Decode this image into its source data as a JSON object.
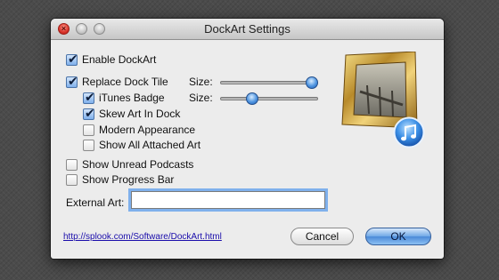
{
  "window": {
    "title": "DockArt Settings"
  },
  "options": {
    "enable_dockart": {
      "label": "Enable DockArt",
      "checked": true
    },
    "replace_dock_tile": {
      "label": "Replace Dock Tile",
      "checked": true
    },
    "itunes_badge": {
      "label": "iTunes Badge",
      "checked": true
    },
    "skew_art": {
      "label": "Skew Art In Dock",
      "checked": true
    },
    "modern_appearance": {
      "label": "Modern Appearance",
      "checked": false
    },
    "show_all_art": {
      "label": "Show All Attached Art",
      "checked": false
    },
    "show_unread_podcasts": {
      "label": "Show Unread Podcasts",
      "checked": false
    },
    "show_progress_bar": {
      "label": "Show Progress Bar",
      "checked": false
    }
  },
  "size_controls": {
    "tile": {
      "label": "Size:",
      "value": 1.0
    },
    "badge": {
      "label": "Size:",
      "value": 0.3
    }
  },
  "external_art": {
    "label": "External Art:",
    "value": ""
  },
  "link": {
    "text": "http://splook.com/Software/DockArt.html"
  },
  "buttons": {
    "cancel": "Cancel",
    "ok": "OK"
  },
  "icons": {
    "art": "framed-artwork-icon",
    "badge": "itunes-music-note-icon"
  },
  "colors": {
    "accent": "#4b8ad8",
    "link": "#1a0dab"
  }
}
